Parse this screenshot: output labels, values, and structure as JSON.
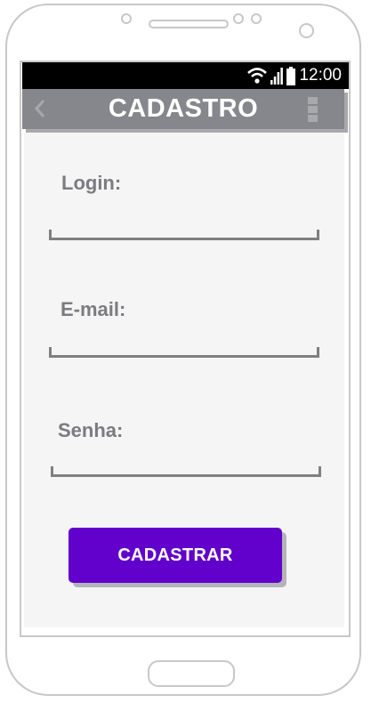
{
  "status_bar": {
    "time": "12:00",
    "icons": [
      "wifi-icon",
      "signal-icon",
      "battery-icon"
    ]
  },
  "app_bar": {
    "title": "CADASTRO",
    "back_icon": "chevron-left-icon",
    "menu_icon": "more-vert-icon",
    "color": "#86878c"
  },
  "form": {
    "login_label": "Login:",
    "login_value": "",
    "email_label": "E-mail:",
    "email_value": "",
    "password_label": "Senha:",
    "password_value": ""
  },
  "submit": {
    "label": "CADASTRAR",
    "color": "#6200cc"
  }
}
